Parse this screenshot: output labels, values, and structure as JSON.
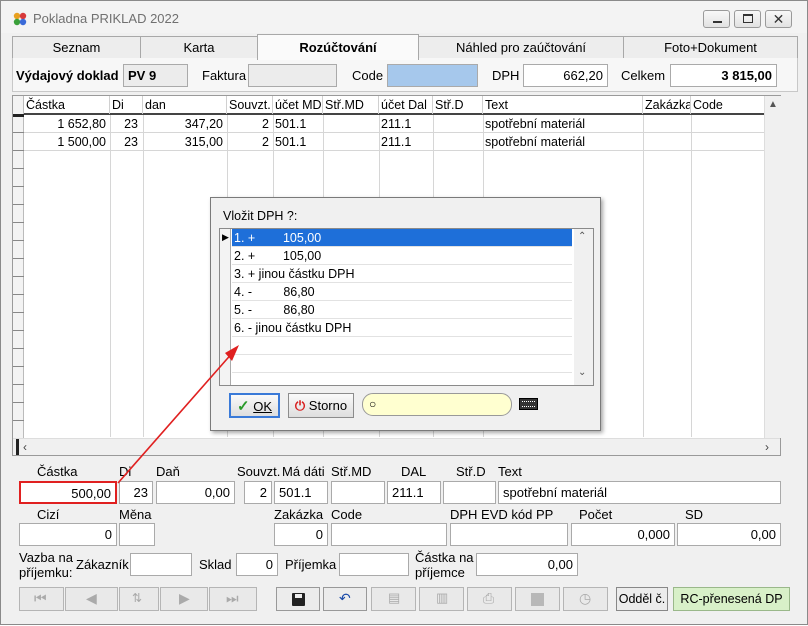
{
  "window": {
    "title": "Pokladna PRIKLAD  2022"
  },
  "tabs": [
    {
      "label": "Seznam"
    },
    {
      "label": "Karta"
    },
    {
      "label": "Rozúčtování"
    },
    {
      "label": "Náhled pro zaúčtování"
    },
    {
      "label": "Foto+Dokument"
    }
  ],
  "doc": {
    "type_label": "Výdajový doklad",
    "code_value": "PV  9",
    "faktura_label": "Faktura",
    "faktura_value": "",
    "code_label": "Code",
    "code_field": "",
    "dph_label": "DPH",
    "dph_value": "662,20",
    "celkem_label": "Celkem",
    "celkem_value": "3 815,00"
  },
  "grid": {
    "columns": [
      "Částka",
      "Di",
      "dan",
      "Souvzt.",
      "účet MD",
      "Stř.MD",
      "účet Dal",
      "Stř.D",
      "Text",
      "Zakázka",
      "Code"
    ],
    "rows": [
      {
        "castka": "1 652,80",
        "di": "23",
        "dan": "347,20",
        "souvzt": "2",
        "ucet_md": "501.1",
        "str_md": "",
        "ucet_dal": "211.1",
        "str_d": "",
        "text": "spotřební materiál",
        "zakazka": "",
        "code": ""
      },
      {
        "castka": "1 500,00",
        "di": "23",
        "dan": "315,00",
        "souvzt": "2",
        "ucet_md": "501.1",
        "str_md": "",
        "ucet_dal": "211.1",
        "str_d": "",
        "text": "spotřební materiál",
        "zakazka": "",
        "code": ""
      }
    ]
  },
  "dialog": {
    "title": "Vložit DPH ?:",
    "items": [
      {
        "label": "1. +        105,00"
      },
      {
        "label": "2. +        105,00"
      },
      {
        "label": "3. + jinou částku DPH"
      },
      {
        "label": "4. -         86,80"
      },
      {
        "label": "5. -         86,80"
      },
      {
        "label": "6. - jinou částku DPH"
      }
    ],
    "selected_index": 0,
    "ok_label": "OK",
    "storno_label": "Storno",
    "search_value": ""
  },
  "detail": {
    "castka_label": "Částka",
    "castka_value": "500,00",
    "di_label": "Di",
    "di_value": "23",
    "dan_label": "Daň",
    "dan_value": "0,00",
    "souvzt_label": "Souvzt.",
    "souvzt_value": "2",
    "ma_dati_label": "Má dáti",
    "ma_dati_value": "501.1",
    "str_md_label": "Stř.MD",
    "str_md_value": "",
    "dal_label": "DAL",
    "dal_value": "211.1",
    "str_d_label": "Stř.D",
    "str_d_value": "",
    "text_label": "Text",
    "text_value": "spotřební materiál",
    "cizi_label": "Cizí",
    "cizi_value": "0",
    "mena_label": "Měna",
    "mena_value": "",
    "zakazka_label": "Zakázka",
    "zakazka_value": "0",
    "code_label": "Code",
    "code_value": "",
    "dph_evd_label": "DPH EVD kód PP",
    "dph_evd_value": "",
    "pocet_label": "Počet",
    "pocet_value": "0,000",
    "sd_label": "SD",
    "sd_value": "0,00",
    "vazba_label_1": "Vazba na",
    "vazba_label_2": "příjemku:",
    "zakaznik_label": "Zákazník",
    "zakaznik_value": "",
    "sklad_label": "Sklad",
    "sklad_value": "0",
    "prijemka_label": "Příjemka",
    "prijemka_value": "",
    "castka_prijemce_label_1": "Částka na",
    "castka_prijemce_label_2": "příjemce",
    "castka_prijemce_value": "0,00"
  },
  "toolbar": {
    "oddel_label": "Odděl č.",
    "rc_label": "RC-přenesená DP"
  },
  "colors": {
    "selection": "#1e6fd9",
    "code_field": "#a6c8ec",
    "search_field": "#ffffd0",
    "rc_button": "#d8f0c8",
    "arrow": "#e02020"
  }
}
